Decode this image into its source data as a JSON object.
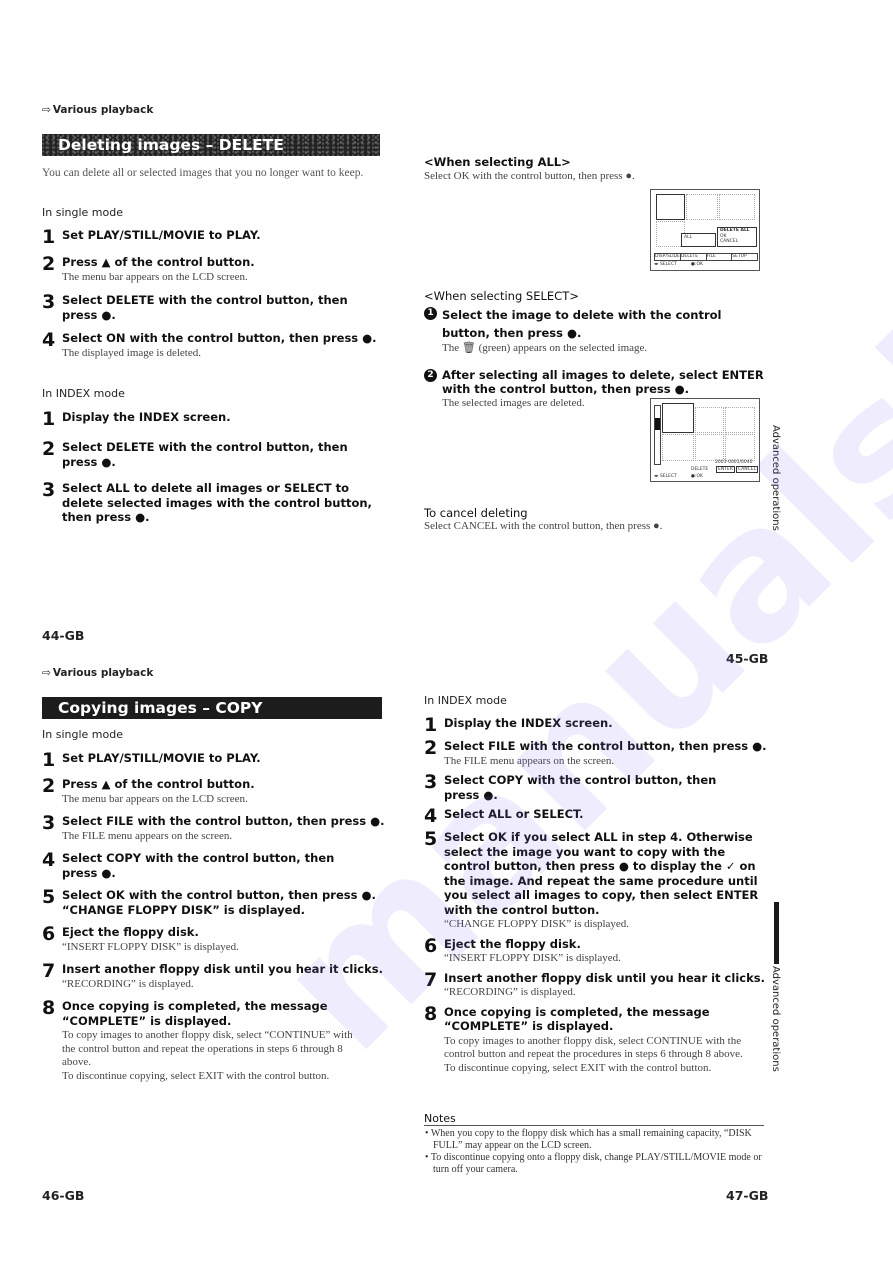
{
  "watermark": "manualslib",
  "top": {
    "breadcrumb": "Various playback",
    "banner": "Deleting images – DELETE",
    "intro": "You can delete all or selected images that you no longer want to keep.",
    "single_mode": {
      "heading": "In single mode",
      "steps": [
        {
          "num": "1",
          "title": "Set PLAY/STILL/MOVIE to PLAY.",
          "desc": ""
        },
        {
          "num": "2",
          "title": "Press ▲ of the control button.",
          "desc": "The menu bar appears on the LCD screen."
        },
        {
          "num": "3",
          "title": "Select DELETE with the control button, then press ●.",
          "desc": ""
        },
        {
          "num": "4",
          "title": "Select ON with the control button, then press ●.",
          "desc": "The displayed image is deleted."
        }
      ]
    },
    "index_mode": {
      "heading": "In INDEX mode",
      "steps": [
        {
          "num": "1",
          "title": "Display the INDEX screen.",
          "desc": ""
        },
        {
          "num": "2",
          "title": "Select DELETE with the control button, then press ●.",
          "desc": ""
        },
        {
          "num": "3",
          "title": "Select ALL to delete all images or SELECT to delete selected images with the control button, then press ●.",
          "desc": ""
        }
      ]
    },
    "when_all": {
      "heading": "<When selecting ALL>",
      "text": "Select OK with the control button, then press ●.",
      "lcd": {
        "menu_left": "ALL",
        "popup_title": "DELETE ALL",
        "popup_ok": "OK",
        "popup_cancel": "CANCEL",
        "tabs": [
          "DISP/SLIDE",
          "DELETE",
          "FILE",
          "SETUP"
        ],
        "footer_left": "◂▸ SELECT",
        "footer_right": "●:OK"
      }
    },
    "when_select": {
      "heading": "<When selecting SELECT>",
      "steps": [
        {
          "num": "1",
          "title": "Select the image to delete with the control button, then press ●.",
          "desc": "The 🗑 (green) appears on the selected image."
        },
        {
          "num": "2",
          "title": "After selecting all images to delete, select ENTER with the control button, then press ●.",
          "desc": "The selected images are deleted."
        }
      ],
      "lcd": {
        "label": "DELETE",
        "counter": "2001-0001/0040",
        "enter": "ENTER",
        "cancel": "CANCEL",
        "footer_left": "◂▸ SELECT",
        "footer_right": "●:OK"
      }
    },
    "cancel": {
      "heading": "To cancel deleting",
      "text": "Select CANCEL with the control button, then press ●."
    },
    "side_tab": "Advanced operations",
    "page_left": "44-GB",
    "page_right": "45-GB"
  },
  "bottom": {
    "breadcrumb": "Various playback",
    "banner": "Copying images – COPY",
    "single_mode": {
      "heading": "In single mode",
      "steps": [
        {
          "num": "1",
          "title": "Set PLAY/STILL/MOVIE to PLAY.",
          "desc": ""
        },
        {
          "num": "2",
          "title": "Press ▲ of the control button.",
          "desc": "The menu bar appears on the LCD screen."
        },
        {
          "num": "3",
          "title": "Select FILE with the control button, then press ●.",
          "desc": "The FILE menu appears on the screen."
        },
        {
          "num": "4",
          "title": "Select COPY with the control button, then press ●.",
          "desc": ""
        },
        {
          "num": "5",
          "title": "Select OK with the control button, then press ●. “CHANGE FLOPPY DISK” is displayed.",
          "desc": ""
        },
        {
          "num": "6",
          "title": "Eject the floppy disk.",
          "desc": "“INSERT FLOPPY DISK” is displayed."
        },
        {
          "num": "7",
          "title": "Insert another floppy disk until you hear it clicks.",
          "desc": "“RECORDING” is displayed."
        },
        {
          "num": "8",
          "title": "Once copying is completed, the message “COMPLETE” is displayed.",
          "desc": "To copy images to another floppy disk, select “CONTINUE” with the control button and repeat the operations in steps 6 through 8 above.\nTo discontinue copying, select EXIT with the control button."
        }
      ]
    },
    "index_mode": {
      "heading": "In INDEX mode",
      "steps": [
        {
          "num": "1",
          "title": "Display the INDEX screen.",
          "desc": ""
        },
        {
          "num": "2",
          "title": "Select FILE with the control button, then press ●.",
          "desc": "The FILE menu appears on the screen."
        },
        {
          "num": "3",
          "title": "Select COPY with the control button, then press ●.",
          "desc": ""
        },
        {
          "num": "4",
          "title": "Select ALL or SELECT.",
          "desc": ""
        },
        {
          "num": "5",
          "title": "Select OK if you select ALL in step 4. Otherwise select the image you want to copy with the control button, then press ● to display the ✓ on the image. And repeat the same procedure until you select all images to copy, then select ENTER with the control button.",
          "desc": "“CHANGE FLOPPY DISK” is displayed."
        },
        {
          "num": "6",
          "title": "Eject the floppy disk.",
          "desc": "“INSERT FLOPPY DISK” is displayed."
        },
        {
          "num": "7",
          "title": "Insert another floppy disk until you hear it clicks.",
          "desc": "“RECORDING” is displayed."
        },
        {
          "num": "8",
          "title": "Once copying is completed, the message “COMPLETE” is displayed.",
          "desc": "To copy images to another floppy disk, select  CONTINUE with the control button and repeat the procedures in steps 6 through 8 above.\nTo discontinue copying, select EXIT with the control button."
        }
      ]
    },
    "notes": {
      "heading": "Notes",
      "items": [
        "When you copy to the floppy disk which has a small remaining capacity, “DISK FULL” may appear on the LCD screen.",
        "To discontinue copying onto a floppy disk, change PLAY/STILL/MOVIE mode or turn off your camera."
      ]
    },
    "side_tab": "Advanced operations",
    "page_left": "46-GB",
    "page_right": "47-GB"
  }
}
